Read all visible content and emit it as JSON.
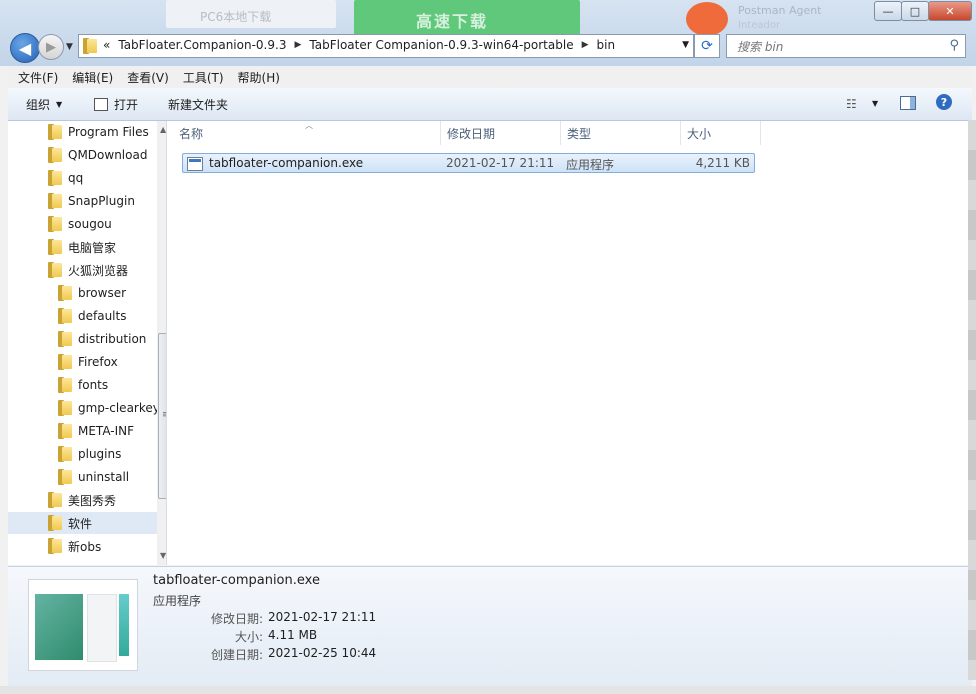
{
  "background": {
    "tab_text": "PC6本地下载",
    "green_button": "高速下载",
    "side_title": "Postman Agent",
    "side_sub": "Inteador"
  },
  "window_buttons": {
    "minimize": "—",
    "maximize": "□",
    "close": "✕"
  },
  "address": {
    "overflow": "«",
    "crumbs": [
      "TabFloater.Companion-0.9.3",
      "TabFloater Companion-0.9.3-win64-portable",
      "bin"
    ]
  },
  "search": {
    "placeholder": "搜索 bin"
  },
  "menu": [
    "文件(F)",
    "编辑(E)",
    "查看(V)",
    "工具(T)",
    "帮助(H)"
  ],
  "toolbar": {
    "organize": "组织",
    "open": "打开",
    "new_folder": "新建文件夹",
    "help": "?"
  },
  "nav_items": [
    {
      "label": "Program Files",
      "indent": 0
    },
    {
      "label": "QMDownload",
      "indent": 0
    },
    {
      "label": "qq",
      "indent": 0
    },
    {
      "label": "SnapPlugin",
      "indent": 0
    },
    {
      "label": "sougou",
      "indent": 0
    },
    {
      "label": "电脑管家",
      "indent": 0
    },
    {
      "label": "火狐浏览器",
      "indent": 0
    },
    {
      "label": "browser",
      "indent": 1
    },
    {
      "label": "defaults",
      "indent": 1
    },
    {
      "label": "distribution",
      "indent": 1
    },
    {
      "label": "Firefox",
      "indent": 1
    },
    {
      "label": "fonts",
      "indent": 1
    },
    {
      "label": "gmp-clearkey",
      "indent": 1
    },
    {
      "label": "META-INF",
      "indent": 1
    },
    {
      "label": "plugins",
      "indent": 1
    },
    {
      "label": "uninstall",
      "indent": 1
    },
    {
      "label": "美图秀秀",
      "indent": 0
    },
    {
      "label": "软件",
      "indent": 0,
      "selected": true
    },
    {
      "label": "新obs",
      "indent": 0
    }
  ],
  "columns": [
    "名称",
    "修改日期",
    "类型",
    "大小"
  ],
  "file": {
    "name": "tabfloater-companion.exe",
    "modified": "2021-02-17 21:11",
    "type": "应用程序",
    "size": "4,211 KB"
  },
  "details": {
    "name": "tabfloater-companion.exe",
    "type": "应用程序",
    "modified_label": "修改日期:",
    "modified": "2021-02-17 21:11",
    "size_label": "大小:",
    "size": "4.11 MB",
    "created_label": "创建日期:",
    "created": "2021-02-25 10:44"
  }
}
